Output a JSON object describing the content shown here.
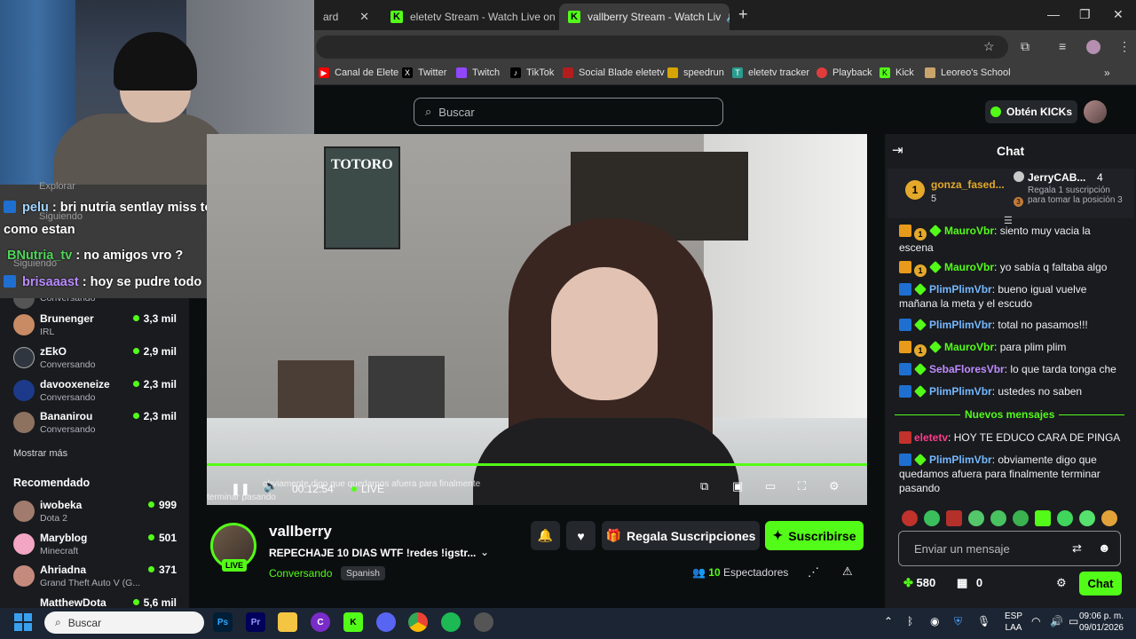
{
  "browser": {
    "tabs": [
      {
        "label": "ard",
        "active": false
      },
      {
        "label": "eletetv Stream - Watch Live on",
        "active": false
      },
      {
        "label": "vallberry Stream - Watch Liv",
        "active": true
      }
    ],
    "bookmarks": [
      "Canal de Elete",
      "Twitter",
      "Twitch",
      "TikTok",
      "Social Blade eletetv",
      "speedrun",
      "eletetv tracker",
      "Playback",
      "Kick",
      "Leoreo's School"
    ]
  },
  "header": {
    "search_placeholder": "Buscar",
    "kicks_button": "Obtén KICKs"
  },
  "overlay_chat": {
    "ghost_explore": "Explorar",
    "ghost_following": "Siguiendo",
    "ghost_following2": "Siguiendo",
    "lines": [
      {
        "user": "pelu",
        "text": "bri nutria sentlay miss toti",
        "cont": "como estan",
        "color": "#2a8cff"
      },
      {
        "user": "BNutria_tv",
        "text": "no amigos vro ?",
        "color": "#3ad34f"
      },
      {
        "user": "brisaaast",
        "text": "hoy se pudre todo",
        "color": "#b06cff"
      }
    ]
  },
  "sidebar": {
    "items": [
      {
        "name": "",
        "cat": "Conversando",
        "viewers": ""
      },
      {
        "name": "Brunenger",
        "cat": "IRL",
        "viewers": "3,3 mil"
      },
      {
        "name": "zEkO",
        "cat": "Conversando",
        "viewers": "2,9 mil"
      },
      {
        "name": "davooxeneize",
        "cat": "Conversando",
        "viewers": "2,3 mil"
      },
      {
        "name": "Bananirou",
        "cat": "Conversando",
        "viewers": "2,3 mil"
      }
    ],
    "show_more": "Mostrar más",
    "recommended_title": "Recomendado",
    "recommended": [
      {
        "name": "iwobeka",
        "cat": "Dota 2",
        "viewers": "999"
      },
      {
        "name": "Maryblog",
        "cat": "Minecraft",
        "viewers": "501"
      },
      {
        "name": "Ahriadna",
        "cat": "Grand Theft Auto V (G...",
        "viewers": "371"
      },
      {
        "name": "MatthewDota",
        "cat": "",
        "viewers": "5,6 mil"
      }
    ]
  },
  "video": {
    "poster_text": "TOTORO",
    "time": "00:12:54",
    "live_label": "LIVE",
    "caption": "obviamente digo que quedamos afuera para finalmente",
    "caption2": "terminar pasando"
  },
  "stream": {
    "channel": "vallberry",
    "live_badge": "LIVE",
    "title": "REPECHAJE 10 DIAS WTF  !redes !igstr...",
    "category": "Conversando",
    "language": "Spanish",
    "gift_label": "Regala Suscripciones",
    "subscribe_label": "Suscribirse",
    "viewers_count": "10",
    "viewers_label": "Espectadores"
  },
  "chat": {
    "title": "Chat",
    "top1": {
      "name": "gonza_fased...",
      "rank": "1",
      "count": "5"
    },
    "top2": {
      "name": "JerryCAB...",
      "count": "4",
      "promo": "Regala 1 suscripción para tomar la posición 3",
      "rank": "3"
    },
    "messages": [
      {
        "user": "MauroVbr",
        "text": "siento muy vacia la escena",
        "color": "#53fc18",
        "badges": "crown"
      },
      {
        "user": "MauroVbr",
        "text": "yo sabía q faltaba algo",
        "color": "#53fc18",
        "badges": "crown"
      },
      {
        "user": "PlimPlimVbr",
        "text": "bueno igual vuelve mañana la meta y el escudo",
        "color": "#75b8ff",
        "badges": "blue"
      },
      {
        "user": "PlimPlimVbr",
        "text": "total no pasamos!!!",
        "color": "#75b8ff",
        "badges": "blue"
      },
      {
        "user": "MauroVbr",
        "text": "para plim plim",
        "color": "#53fc18",
        "badges": "crown"
      },
      {
        "user": "SebaFloresVbr",
        "text": "lo que tarda tonga che",
        "color": "#c08cff",
        "badges": "blue"
      },
      {
        "user": "PlimPlimVbr",
        "text": "ustedes no saben",
        "color": "#75b8ff",
        "badges": "blue"
      }
    ],
    "new_messages": "Nuevos mensajes",
    "after": [
      {
        "user": "eletetv",
        "text": "HOY TE EDUCO CARA DE PINGA",
        "color": "#ff3c8a",
        "badges": "red"
      },
      {
        "user": "PlimPlimVbr",
        "text": "obviamente digo que quedamos afuera para finalmente terminar pasando",
        "color": "#75b8ff",
        "badges": "blue"
      }
    ],
    "input_placeholder": "Enviar un mensaje",
    "points": "580",
    "gift_count": "0",
    "send_label": "Chat"
  },
  "taskbar": {
    "search_placeholder": "Buscar",
    "lang": "ESP",
    "lang2": "LAA",
    "time": "09:06 p. m.",
    "date": "09/01/2026"
  }
}
